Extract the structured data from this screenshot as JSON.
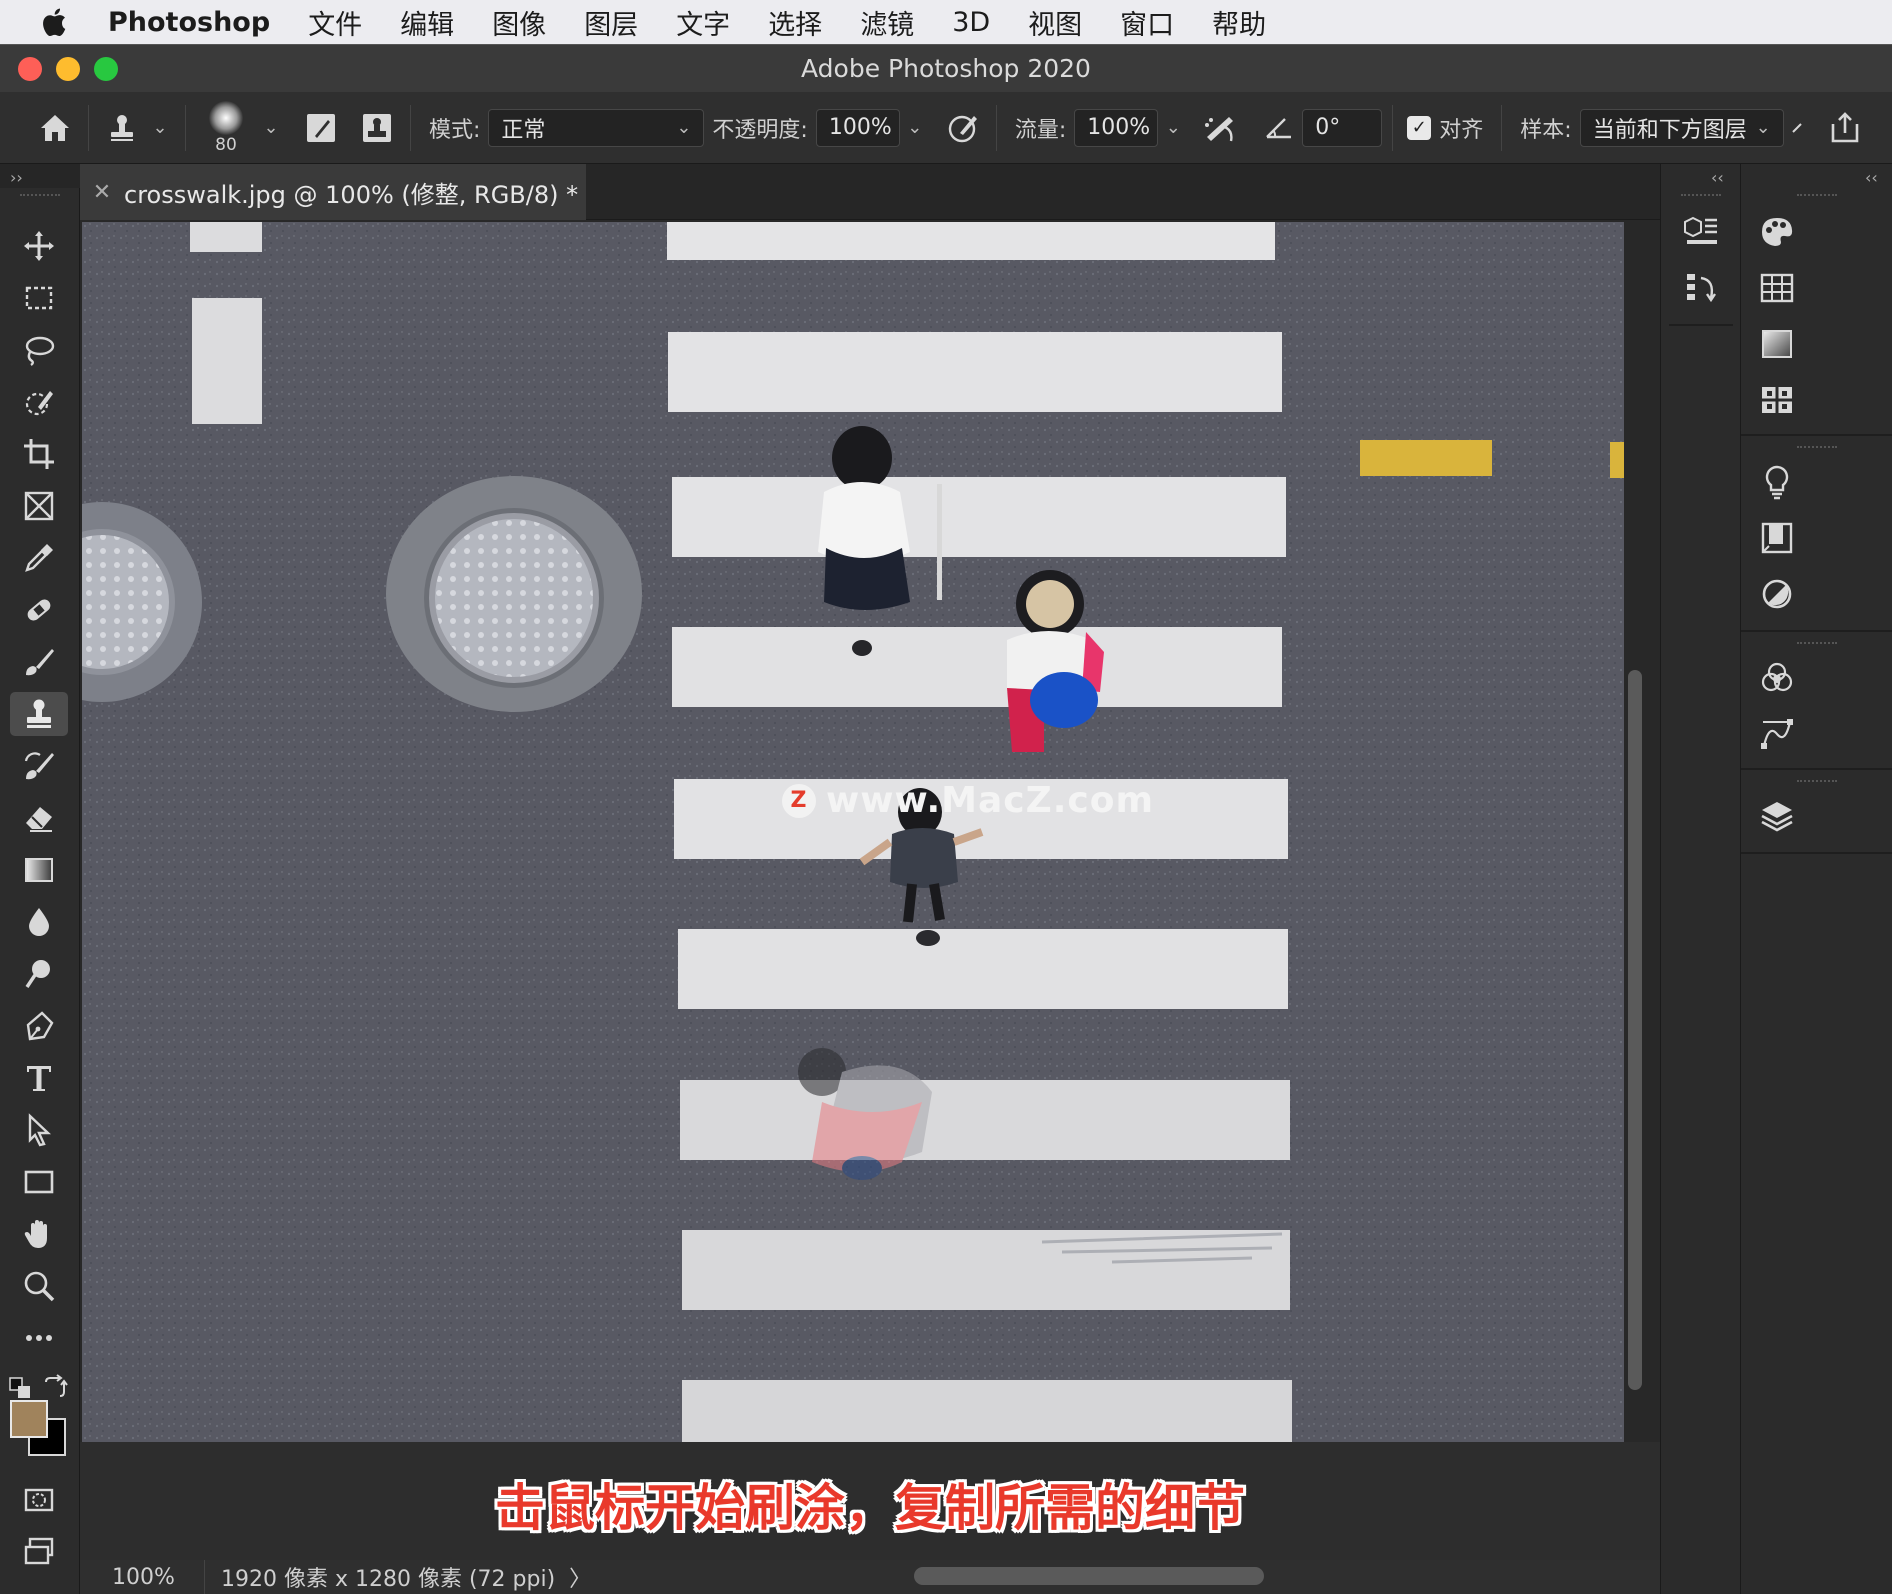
{
  "menubar": {
    "app": "Photoshop",
    "items": [
      "文件",
      "编辑",
      "图像",
      "图层",
      "文字",
      "选择",
      "滤镜",
      "3D",
      "视图",
      "窗口",
      "帮助"
    ]
  },
  "window": {
    "title": "Adobe Photoshop 2020"
  },
  "options": {
    "brush_size": "80",
    "mode_label": "模式:",
    "mode_value": "正常",
    "opacity_label": "不透明度:",
    "opacity_value": "100%",
    "flow_label": "流量:",
    "flow_value": "100%",
    "angle_value": "0°",
    "aligned_label": "对齐",
    "aligned_checked": true,
    "sample_label": "样本:",
    "sample_value": "当前和下方图层"
  },
  "document": {
    "tab_title": "crosswalk.jpg @ 100% (修整, RGB/8) *",
    "watermark": "www.MacZ.com",
    "watermark_logo": "Z"
  },
  "subtitle": "击鼠标开始刷涂，复制所需的细节",
  "status": {
    "zoom": "100%",
    "doc_info": "1920 像素 x 1280 像素 (72 ppi)",
    "arrow": "〉"
  },
  "tools": [
    {
      "name": "move-tool-icon"
    },
    {
      "name": "marquee-tool-icon"
    },
    {
      "name": "lasso-tool-icon"
    },
    {
      "name": "quick-select-tool-icon"
    },
    {
      "name": "crop-tool-icon"
    },
    {
      "name": "frame-tool-icon"
    },
    {
      "name": "eyedropper-tool-icon"
    },
    {
      "name": "healing-brush-tool-icon"
    },
    {
      "name": "brush-tool-icon"
    },
    {
      "name": "clone-stamp-tool-icon",
      "active": true
    },
    {
      "name": "history-brush-tool-icon"
    },
    {
      "name": "eraser-tool-icon"
    },
    {
      "name": "gradient-tool-icon"
    },
    {
      "name": "blur-tool-icon"
    },
    {
      "name": "dodge-tool-icon"
    },
    {
      "name": "pen-tool-icon"
    },
    {
      "name": "type-tool-icon"
    },
    {
      "name": "path-select-tool-icon"
    },
    {
      "name": "rectangle-tool-icon"
    },
    {
      "name": "hand-tool-icon"
    },
    {
      "name": "zoom-tool-icon"
    },
    {
      "name": "more-tools-icon"
    }
  ],
  "colors": {
    "foreground": "#a0835c",
    "background": "#000000",
    "accent_red": "#e9392b"
  }
}
